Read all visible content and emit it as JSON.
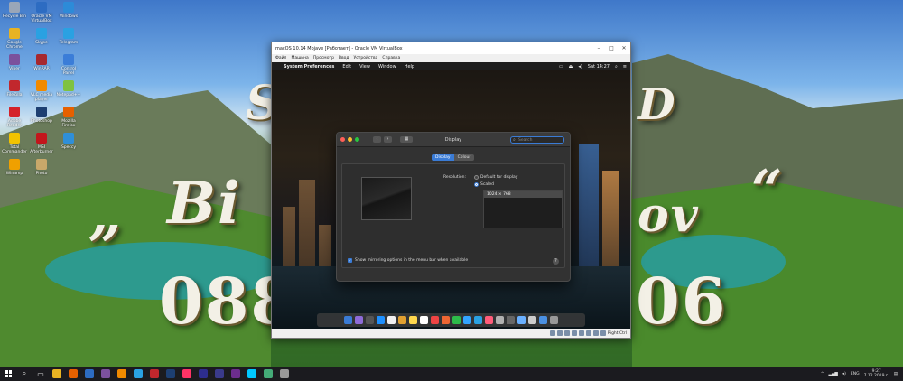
{
  "desktop": {
    "background_text": {
      "line1_left": "S",
      "line1_right": "D",
      "quote_open": "„",
      "name_left": "Bi",
      "name_right": "ov",
      "quote_close": "“",
      "phone_left": "088",
      "phone_right": "06"
    },
    "icons": [
      {
        "label": "Recycle Bin",
        "color": "#9aa6b8"
      },
      {
        "label": "Oracle VM VirtualBox",
        "color": "#2d6cc2"
      },
      {
        "label": "Windows",
        "color": "#2d8bd8"
      },
      {
        "label": "Google Chrome",
        "color": "#e8b323"
      },
      {
        "label": "Skype",
        "color": "#2aa1e2"
      },
      {
        "label": "Telegram",
        "color": "#2aa1e2"
      },
      {
        "label": "Viber",
        "color": "#7b519d"
      },
      {
        "label": "WinRAR",
        "color": "#a7282e"
      },
      {
        "label": "Control Panel",
        "color": "#3b7dd8"
      },
      {
        "label": "FileZilla",
        "color": "#c1272d"
      },
      {
        "label": "VLC media player",
        "color": "#f08a00"
      },
      {
        "label": "Notepad++",
        "color": "#7fc241"
      },
      {
        "label": "Adobe Reader",
        "color": "#d4222a"
      },
      {
        "label": "Photoshop",
        "color": "#1d3f72"
      },
      {
        "label": "Mozilla Firefox",
        "color": "#e66000"
      },
      {
        "label": "Total Commander",
        "color": "#f2c300"
      },
      {
        "label": "MSI Afterburner",
        "color": "#c3161c"
      },
      {
        "label": "Speccy",
        "color": "#2f8fd8"
      },
      {
        "label": "Winamp",
        "color": "#f0a000"
      },
      {
        "label": "Photo",
        "color": "#c9a86a"
      }
    ]
  },
  "vm_window": {
    "title": "macOS 10.14 Mojave [Работает] - Oracle VM VirtualBox",
    "menu": [
      "Файл",
      "Машина",
      "Просмотр",
      "Ввод",
      "Устройства",
      "Справка"
    ],
    "mac_menubar": {
      "apple_glyph": "",
      "app_name": "System Preferences",
      "items": [
        "Edit",
        "View",
        "Window",
        "Help"
      ],
      "clock": "Sat 14:27"
    },
    "status_right": "Right Ctrl"
  },
  "prefs": {
    "title": "Display",
    "search_placeholder": "Search",
    "tabs": [
      {
        "label": "Display",
        "active": true
      },
      {
        "label": "Colour",
        "active": false
      }
    ],
    "resolution_label": "Resolution:",
    "options": [
      {
        "label": "Default for display",
        "selected": false
      },
      {
        "label": "Scaled",
        "selected": true
      }
    ],
    "resolutions": [
      "1024 × 768"
    ],
    "mirror_label": "Show mirroring options in the menu bar when available",
    "mirror_checked": true,
    "help_glyph": "?"
  },
  "dock": {
    "items": [
      "#3a7bd5",
      "#8e6bd8",
      "#555",
      "#1e90ff",
      "#f0f0f0",
      "#e0a030",
      "#ffd84d",
      "#fff",
      "#ee4444",
      "#e63",
      "#2dbb4a",
      "#33a4ff",
      "#2aa1e2",
      "#ff5c7a",
      "#b0b0b0",
      "#666",
      "#6ab0ff",
      "#ccc",
      "#4a90e2",
      "#999"
    ]
  },
  "taskbar": {
    "search_glyph": "⌕",
    "taskview_glyph": "▭",
    "apps": [
      "#e8b323",
      "#e66000",
      "#2d6cc2",
      "#7b519d",
      "#f08a00",
      "#2aa1e2",
      "#c1272d",
      "#1d3f72",
      "#ff3366",
      "#2d2d8d",
      "#3a3a8a",
      "#6c2d8d",
      "#00c8ff",
      "#4a7",
      "#999"
    ],
    "tray_lang": "ENG",
    "clock_time": "9:27",
    "clock_date": "7.12.2019 г."
  }
}
